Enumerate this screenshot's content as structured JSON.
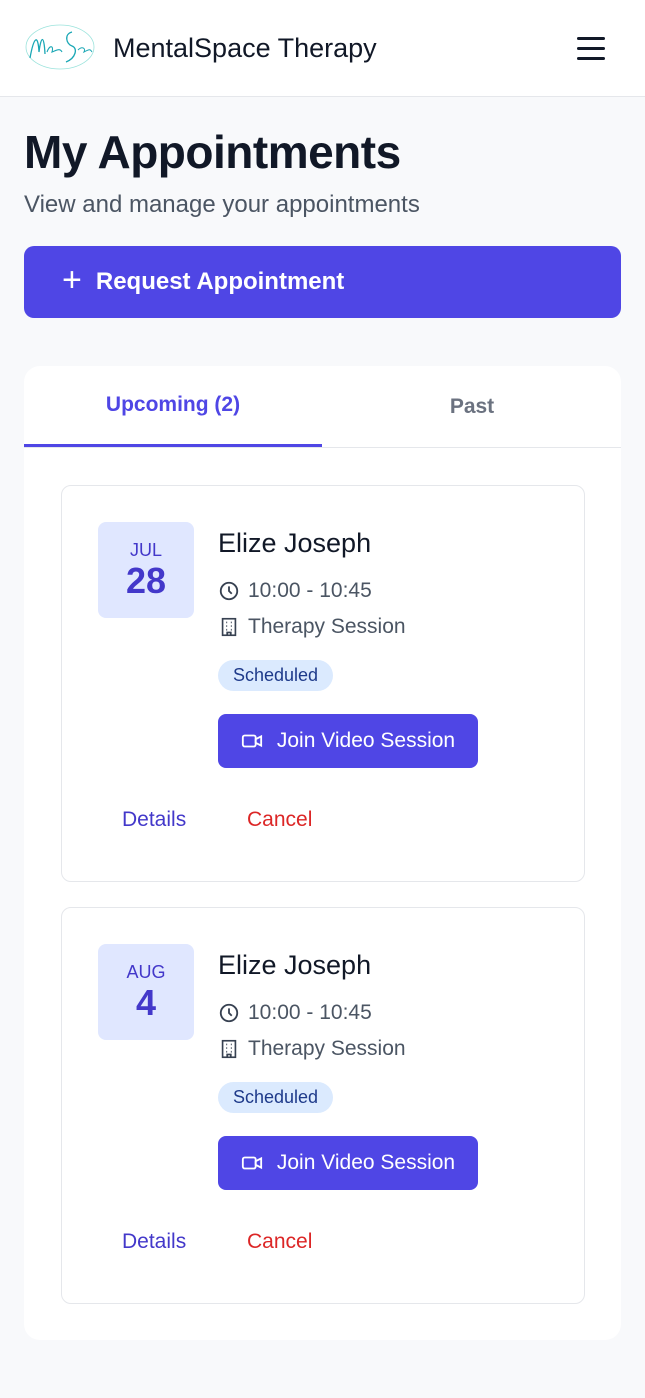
{
  "header": {
    "brand": "MentalSpace Therapy",
    "logo_text": "MentalSpace",
    "menu_icon": "hamburger-menu-icon"
  },
  "page": {
    "title": "My Appointments",
    "subtitle": "View and manage your appointments",
    "request_button": "Request Appointment"
  },
  "tabs": {
    "upcoming": "Upcoming (2)",
    "past": "Past"
  },
  "appointments": [
    {
      "month": "JUL",
      "day": "28",
      "name": "Elize Joseph",
      "time": "10:00 - 10:45",
      "type": "Therapy Session",
      "status": "Scheduled",
      "join_label": "Join Video Session",
      "details_label": "Details",
      "cancel_label": "Cancel"
    },
    {
      "month": "AUG",
      "day": "4",
      "name": "Elize Joseph",
      "time": "10:00 - 10:45",
      "type": "Therapy Session",
      "status": "Scheduled",
      "join_label": "Join Video Session",
      "details_label": "Details",
      "cancel_label": "Cancel"
    }
  ],
  "colors": {
    "primary": "#4f46e5",
    "danger": "#dc2626",
    "badge_bg": "#dbeafe",
    "date_bg": "#e0e7ff"
  }
}
